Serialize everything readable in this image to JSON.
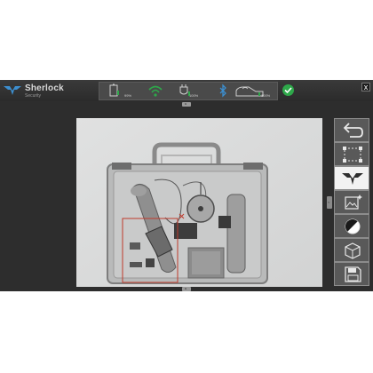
{
  "app": {
    "brand": "Sherlock",
    "brand_sub": "Security"
  },
  "status": {
    "battery_value": "99%",
    "wifi_value": "",
    "power_value": "100%",
    "bluetooth_value": "",
    "scanner_value": "100%"
  },
  "window": {
    "close_label": "x"
  },
  "tabs": {
    "top_label": "u",
    "bottom_label": "u",
    "side_label": "<"
  },
  "toolbar": [
    {
      "name": "undo"
    },
    {
      "name": "region-select"
    },
    {
      "name": "logo-mode"
    },
    {
      "name": "image-filter"
    },
    {
      "name": "contrast"
    },
    {
      "name": "3d-view"
    },
    {
      "name": "save"
    }
  ],
  "colors": {
    "status_ok": "#2ea84a",
    "selection": "#c0392b",
    "background": "#2d2d2d"
  }
}
